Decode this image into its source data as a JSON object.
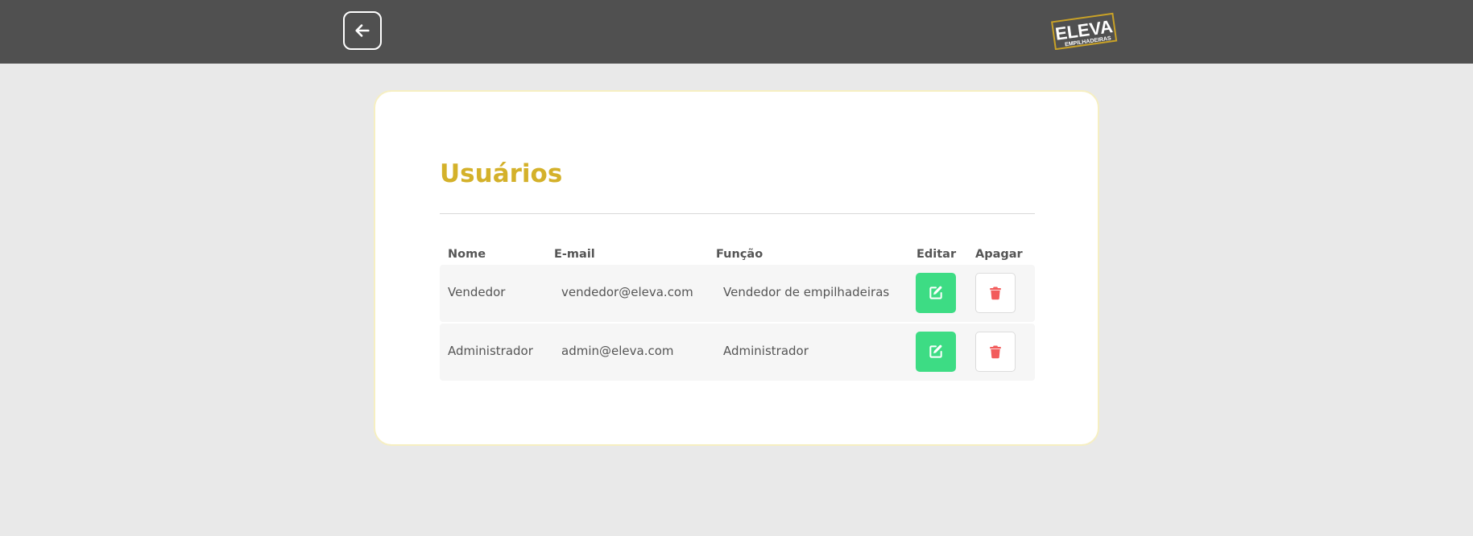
{
  "header": {
    "back_icon": "arrow-left-icon",
    "logo_text": "ELEVA",
    "logo_subtext": "EMPILHADEIRAS"
  },
  "main": {
    "title": "Usuários",
    "columns": {
      "name": "Nome",
      "email": "E-mail",
      "role": "Função",
      "edit": "Editar",
      "delete": "Apagar"
    },
    "rows": [
      {
        "name": "Vendedor",
        "email": "vendedor@eleva.com",
        "role": "Vendedor de empilhadeiras"
      },
      {
        "name": "Administrador",
        "email": "admin@eleva.com",
        "role": "Administrador"
      }
    ]
  },
  "icons": {
    "edit": "edit-icon",
    "delete": "trash-icon"
  },
  "colors": {
    "header_bg": "#505050",
    "page_bg": "#e9e9e9",
    "title": "#d4b12a",
    "edit_button": "#3ddc84",
    "delete_icon": "#f25c5c",
    "card_border": "#f6efc2"
  }
}
